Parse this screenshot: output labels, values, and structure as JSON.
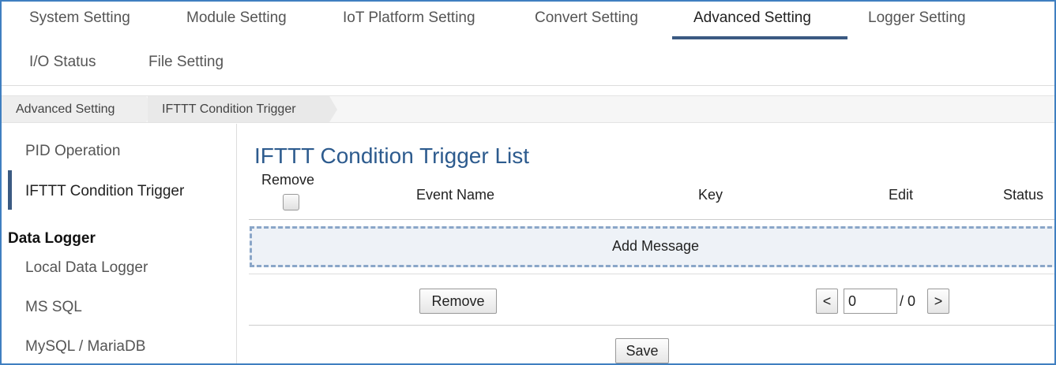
{
  "tabs": [
    {
      "label": "System Setting"
    },
    {
      "label": "Module Setting"
    },
    {
      "label": "IoT Platform Setting"
    },
    {
      "label": "Convert Setting"
    },
    {
      "label": "Advanced Setting",
      "active": true
    },
    {
      "label": "Logger Setting"
    },
    {
      "label": "I/O Status"
    },
    {
      "label": "File Setting"
    }
  ],
  "breadcrumb": [
    "Advanced Setting",
    "IFTTT Condition Trigger"
  ],
  "sidebar": {
    "items": [
      {
        "label": "PID Operation"
      },
      {
        "label": "IFTTT Condition Trigger",
        "active": true
      }
    ],
    "section_title": "Data Logger",
    "section_items": [
      {
        "label": "Local Data Logger"
      },
      {
        "label": "MS SQL"
      },
      {
        "label": "MySQL / MariaDB"
      }
    ]
  },
  "main": {
    "title": "IFTTT Condition Trigger List",
    "columns": {
      "remove": "Remove",
      "event_name": "Event Name",
      "key": "Key",
      "edit": "Edit",
      "status": "Status"
    },
    "add_message": "Add Message",
    "remove_button": "Remove",
    "pager": {
      "prev": "<",
      "next": ">",
      "current": "0",
      "total_text": "/ 0"
    },
    "save_button": "Save"
  },
  "colors": {
    "accent": "#3b5a82",
    "title": "#2d5b8e",
    "frame": "#3f7fc0",
    "add_bg": "#eef2f7"
  }
}
